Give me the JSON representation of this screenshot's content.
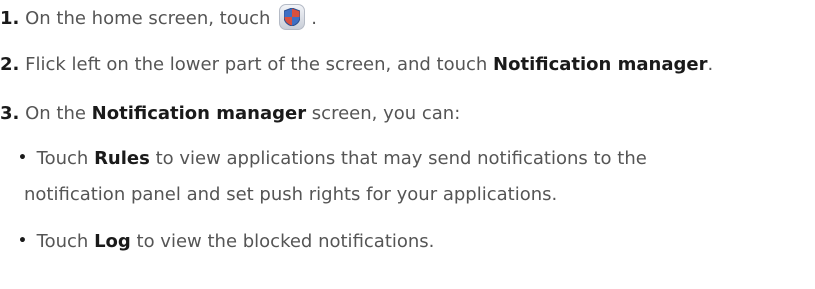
{
  "steps": [
    {
      "number": "1.",
      "text_before": " On the home screen, touch",
      "icon": "phone-manager-shield-icon",
      "text_after": " ."
    },
    {
      "number": "2.",
      "text_before": " Flick left on the lower part of the screen, and touch ",
      "bold": "Notification manager",
      "text_after": "."
    },
    {
      "number": "3.",
      "text_before": " On the ",
      "bold": "Notification manager",
      "text_after": " screen, you can:"
    }
  ],
  "bullets": [
    {
      "marker": "•",
      "text_before": " Touch ",
      "bold": "Rules",
      "text_after": " to view applications that may send notifications to the",
      "continuation": "notification panel and set push rights for your applications."
    },
    {
      "marker": "•",
      "text_before": " Touch ",
      "bold": "Log",
      "text_after": " to view the blocked notifications."
    }
  ],
  "colors": {
    "shield_blue": "#3f6fc4",
    "shield_red": "#d9503f",
    "text": "#555555",
    "bold_text": "#1a1a1a"
  }
}
